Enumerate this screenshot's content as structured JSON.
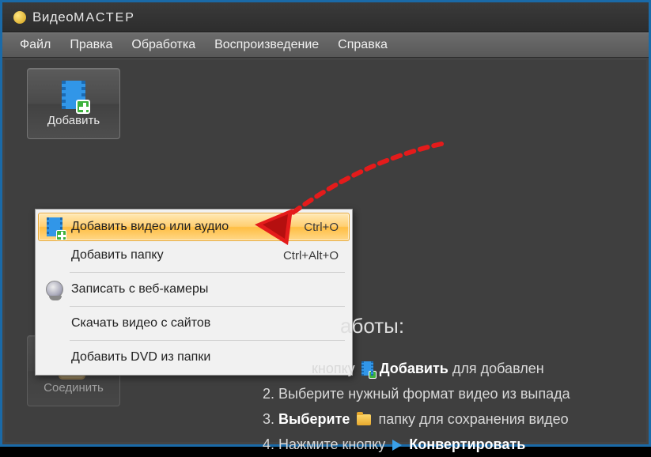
{
  "titlebar": {
    "app_name_part1": "Видео",
    "app_name_part2": "МАСТЕР"
  },
  "menubar": {
    "items": [
      "Файл",
      "Правка",
      "Обработка",
      "Воспроизведение",
      "Справка"
    ]
  },
  "sidebar": {
    "add": {
      "label": "Добавить"
    },
    "join": {
      "label": "Соединить"
    }
  },
  "context_menu": {
    "items": [
      {
        "label": "Добавить видео или аудио",
        "shortcut": "Ctrl+O",
        "icon": "film-plus-icon",
        "highlight": true
      },
      {
        "label": "Добавить папку",
        "shortcut": "Ctrl+Alt+O",
        "icon": ""
      },
      {
        "label": "Записать с веб-камеры",
        "shortcut": "",
        "icon": "webcam-icon"
      },
      {
        "label": "Скачать видео с сайтов",
        "shortcut": "",
        "icon": ""
      },
      {
        "label": "Добавить DVD из папки",
        "shortcut": "",
        "icon": ""
      }
    ]
  },
  "instructions": {
    "heading_tail": "аботы:",
    "line1_tail_a": "кнопку",
    "line1_bold": "Добавить",
    "line1_tail_b": "для добавлен",
    "line2_a": "2. Выберите нужный формат видео из выпада",
    "line3_a": "3. ",
    "line3_bold": "Выберите",
    "line3_b": "папку для сохранения видео",
    "line4_a": "4. Нажмите кнопку",
    "line4_bold": "Конвертировать"
  }
}
